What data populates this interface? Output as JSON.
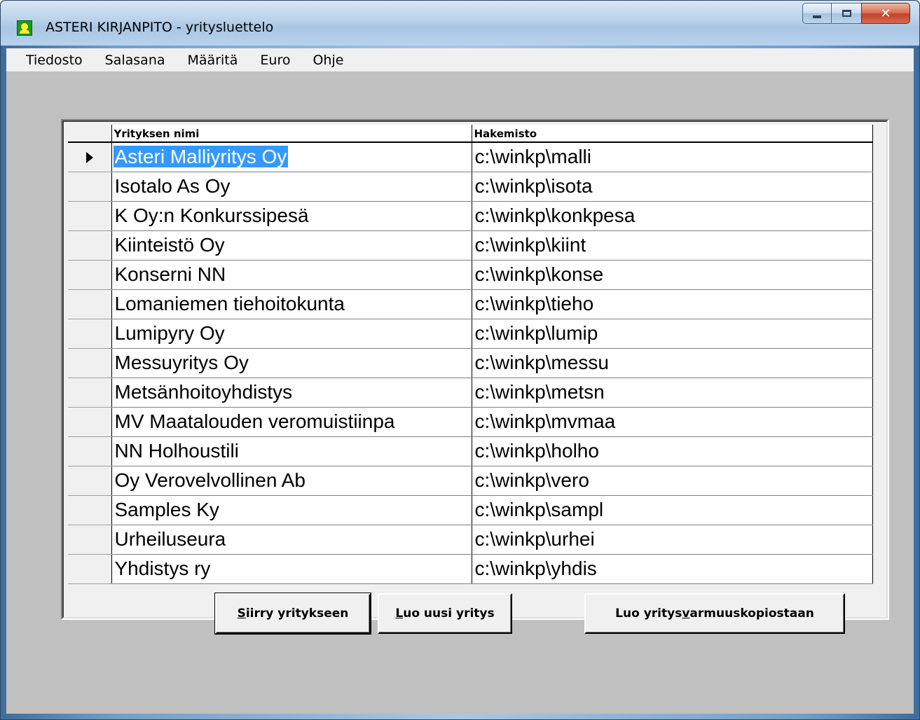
{
  "window": {
    "title": "ASTERI KIRJANPITO - yritysluettelo",
    "controls": {
      "minimize": "minimize-icon",
      "maximize": "maximize-icon",
      "close": "close-icon"
    }
  },
  "menu": [
    "Tiedosto",
    "Salasana",
    "Määritä",
    "Euro",
    "Ohje"
  ],
  "grid": {
    "columns": [
      "Yrityksen nimi",
      "Hakemisto"
    ],
    "selected_row": 0,
    "rows": [
      {
        "name": "Asteri Malliyritys Oy",
        "dir": "c:\\winkp\\malli"
      },
      {
        "name": "Isotalo As Oy",
        "dir": "c:\\winkp\\isota"
      },
      {
        "name": "K Oy:n Konkurssipesä",
        "dir": "c:\\winkp\\konkpesa"
      },
      {
        "name": "Kiinteistö Oy",
        "dir": "c:\\winkp\\kiint"
      },
      {
        "name": "Konserni NN",
        "dir": "c:\\winkp\\konse"
      },
      {
        "name": "Lomaniemen tiehoitokunta",
        "dir": "c:\\winkp\\tieho"
      },
      {
        "name": "Lumipyry Oy",
        "dir": "c:\\winkp\\lumip"
      },
      {
        "name": "Messuyritys Oy",
        "dir": "c:\\winkp\\messu"
      },
      {
        "name": "Metsänhoitoyhdistys",
        "dir": "c:\\winkp\\metsn"
      },
      {
        "name": "MV Maatalouden veromuistiinpa",
        "dir": "c:\\winkp\\mvmaa"
      },
      {
        "name": "NN Holhoustili",
        "dir": "c:\\winkp\\holho"
      },
      {
        "name": "Oy Verovelvollinen Ab",
        "dir": "c:\\winkp\\vero"
      },
      {
        "name": "Samples Ky",
        "dir": "c:\\winkp\\sampl"
      },
      {
        "name": "Urheiluseura",
        "dir": "c:\\winkp\\urhei"
      },
      {
        "name": "Yhdistys ry",
        "dir": "c:\\winkp\\yhdis"
      }
    ]
  },
  "buttons": {
    "enter": {
      "before": "",
      "accel": "S",
      "after": "iirry yritykseen"
    },
    "new": {
      "before": "",
      "accel": "L",
      "after": "uo uusi yritys"
    },
    "backup": {
      "before": "Luo yritys ",
      "accel": "v",
      "after": "armuuskopiostaan"
    }
  }
}
